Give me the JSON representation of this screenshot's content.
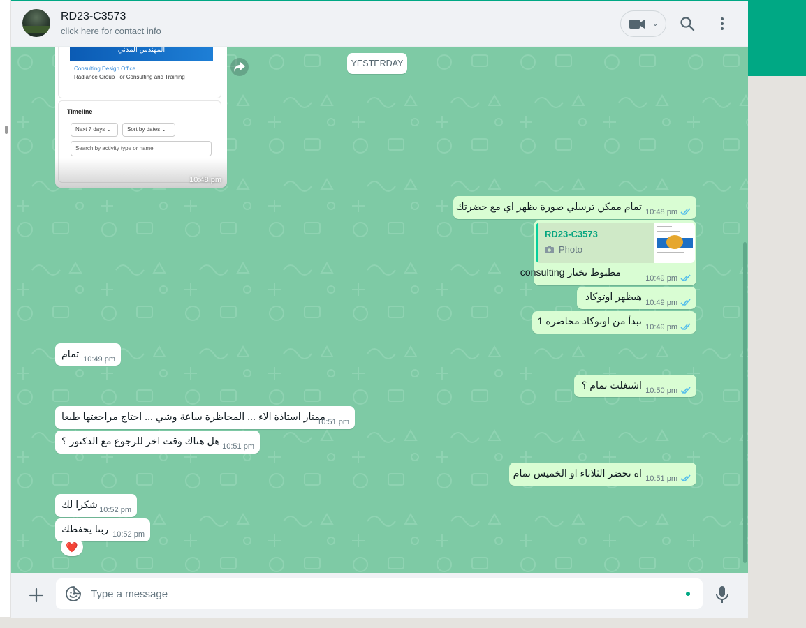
{
  "window": {
    "accent": "#00a884",
    "chat_bg": "#7ecaa5",
    "out_bubble": "#d9fdd3",
    "in_bubble": "#ffffff"
  },
  "header": {
    "contact_name": "RD23-C3573",
    "contact_sub": "click here for contact info",
    "icons": [
      "video-icon",
      "chevron-down-icon",
      "search-icon",
      "menu-icon"
    ]
  },
  "chat": {
    "date_chip": "YESTERDAY",
    "image_message": {
      "banner_text": "المهندس المدني",
      "line1": "Consulting Design Office",
      "line2": "Radiance Group For Consulting and Training",
      "timeline_title": "Timeline",
      "filter1": "Next 7 days ⌄",
      "filter2": "Sort by dates ⌄",
      "search_placeholder": "Search by activity type or name",
      "time": "10:48 pm"
    },
    "messages": [
      {
        "dir": "out",
        "text": "تمام ممكن ترسلي صورة يظهر اي مع حضرتك",
        "time": "10:48 pm"
      },
      {
        "dir": "out",
        "text": "مظبوط نختار consulting",
        "time": "10:49 pm",
        "quote": {
          "name": "RD23-C3573",
          "label": "Photo"
        }
      },
      {
        "dir": "out",
        "text": "هيظهر اوتوكاد",
        "time": "10:49 pm"
      },
      {
        "dir": "out",
        "text": "نبدأ من اوتوكاد محاضره 1",
        "time": "10:49 pm"
      },
      {
        "dir": "in",
        "text": "تمام",
        "time": "10:49 pm"
      },
      {
        "dir": "out",
        "text": "اشتغلت تمام ؟",
        "time": "10:50 pm"
      },
      {
        "dir": "in",
        "text": "ممتاز استاذة الاء ... المحاظرة ساعة وشي ... احتاج مراجعتها طبعا",
        "time": "10:51 pm"
      },
      {
        "dir": "in",
        "text": "هل هناك وقت اخر للرجوع مع الدكتور ؟",
        "time": "10:51 pm"
      },
      {
        "dir": "out",
        "text": "اه نحضر الثلاثاء او الخميس تمام",
        "time": "10:51 pm"
      },
      {
        "dir": "in",
        "text": "شكرا لك",
        "time": "10:52 pm"
      },
      {
        "dir": "in",
        "text": "ربنا يحفظك",
        "time": "10:52 pm",
        "reaction": "❤️"
      }
    ]
  },
  "composer": {
    "placeholder": "Type a message",
    "icons": [
      "plus-icon",
      "sticker-icon",
      "mic-icon"
    ]
  }
}
